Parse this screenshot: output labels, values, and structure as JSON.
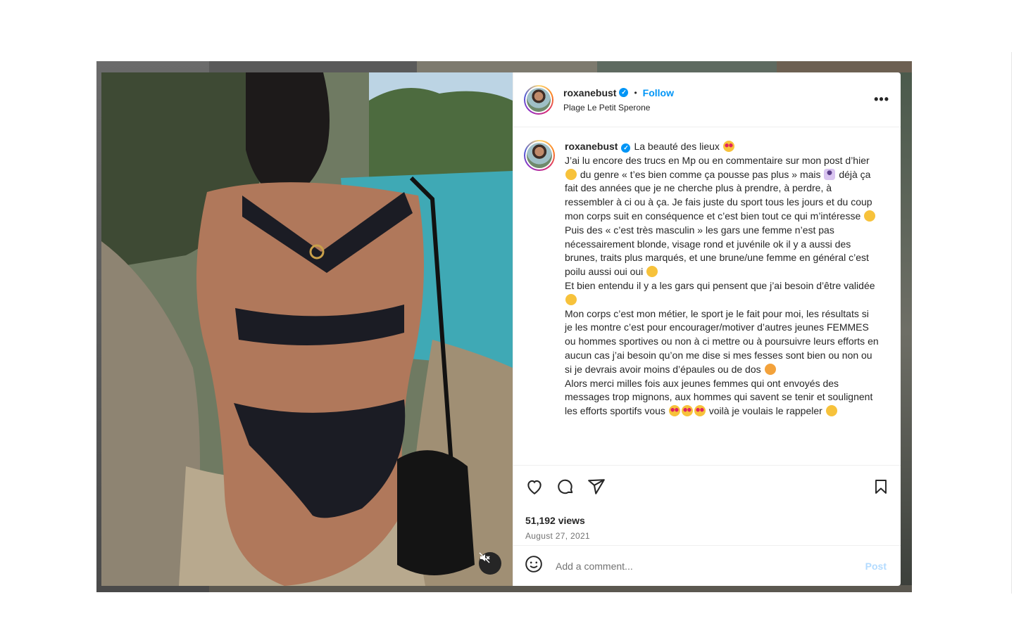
{
  "post": {
    "username": "roxanebust",
    "follow_label": "Follow",
    "separator": "•",
    "location": "Plage Le Petit Sperone",
    "more_label": "•••"
  },
  "caption": {
    "username": "roxanebust",
    "p1": "La beauté des lieux",
    "p2a": "J’ai lu encore des trucs en Mp ou en commentaire sur mon post d’hier",
    "p2b": "du genre « t’es bien comme ça pousse pas plus » mais",
    "p2c": "déjà ça fait des années que je ne cherche plus à prendre, à perdre, à ressembler à ci ou à ça. Je fais juste du sport tous les jours et du coup mon corps suit en conséquence et c’est bien tout ce qui m’intéresse",
    "p3": "Puis des « c’est très masculin » les gars une femme n’est pas nécessairement blonde, visage rond et juvénile ok il y a aussi des brunes, traits plus marqués, et une brune/une femme en général c’est poilu aussi oui oui",
    "p4": "Et bien entendu il y a les gars qui pensent que j’ai besoin d’être validée",
    "p5": "Mon corps c’est mon métier, le sport je le fait pour moi, les résultats si je les montre c’est pour encourager/motiver d’autres jeunes FEMMES ou hommes sportives ou non à ci mettre ou à poursuivre leurs efforts en aucun cas j’ai besoin qu’on me dise si mes fesses sont bien ou non ou si je devrais avoir moins d’épaules ou de dos",
    "p6a": "Alors merci milles fois aux jeunes femmes qui ont envoyés des messages trop mignons, aux hommes qui savent se tenir et soulignent les efforts sportifs vous",
    "p6b": "voilà je voulais le rappeler"
  },
  "stats": {
    "views": "51,192 views",
    "date": "August 27, 2021"
  },
  "comment": {
    "placeholder": "Add a comment...",
    "post_label": "Post"
  },
  "icons": {
    "like": "heart-icon",
    "comment": "comment-icon",
    "share": "share-icon",
    "save": "bookmark-icon",
    "emoji": "smiley-icon",
    "mute": "muted-speaker-icon",
    "verified": "verified-badge-icon"
  },
  "colors": {
    "accent": "#0095f6",
    "post_disabled": "#b3dbff",
    "muted_text": "#737373"
  }
}
